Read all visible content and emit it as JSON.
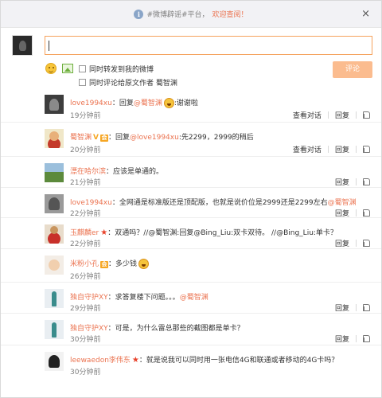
{
  "topbar": {
    "tag": "#微博辟谣#平台，",
    "welcome": "欢迎查阅！",
    "close_label": "×"
  },
  "composer": {
    "forward_label": "同时转发到我的微博",
    "comment_label": "同时评论给原文作者 蜀智渊",
    "submit_label": "评论"
  },
  "actions": {
    "view_conversation": "查看对话",
    "reply": "回复",
    "sep": "|"
  },
  "comments": [
    {
      "user": "love1994xu",
      "pre": "：回复",
      "mention": "@蜀智渊",
      "text": ":谢谢啦",
      "time": "19分钟前",
      "has_conversation": true
    },
    {
      "user": "蜀智渊",
      "pre": "：回复",
      "mention": "@love1994xu",
      "text": ":先2299，2999的稍后",
      "time": "20分钟前",
      "has_conversation": true
    },
    {
      "user": "漂在哈尔滨",
      "text": "：应该是单通的。",
      "time": "21分钟前"
    },
    {
      "user": "love1994xu",
      "text": "：全网通是标准版还是顶配版，也就是说价位是2999还是2299左右",
      "mention": "@蜀智渊",
      "time": "22分钟前"
    },
    {
      "user": "玉麒麟er",
      "text": "：双通吗？//@蜀智渊:回复@Bing_Liu:双卡双待。 //@Bing_Liu:单卡？",
      "time": "22分钟前"
    },
    {
      "user": "米粉小孔",
      "text": "：多少钱",
      "time": "26分钟前"
    },
    {
      "user": "独自守护XY",
      "text": "：求答复楼下问题。。。",
      "mention": "@蜀智渊",
      "time": "29分钟前"
    },
    {
      "user": "独自守护XY",
      "text": "：可是，为什么雷总那些的截图都是单卡？",
      "time": "30分钟前"
    },
    {
      "user": "leewaedon李伟东",
      "text": "：就是说我可以同时用一张电信4G和联通或者移动的4G卡吗？",
      "time": "30分钟前"
    }
  ]
}
